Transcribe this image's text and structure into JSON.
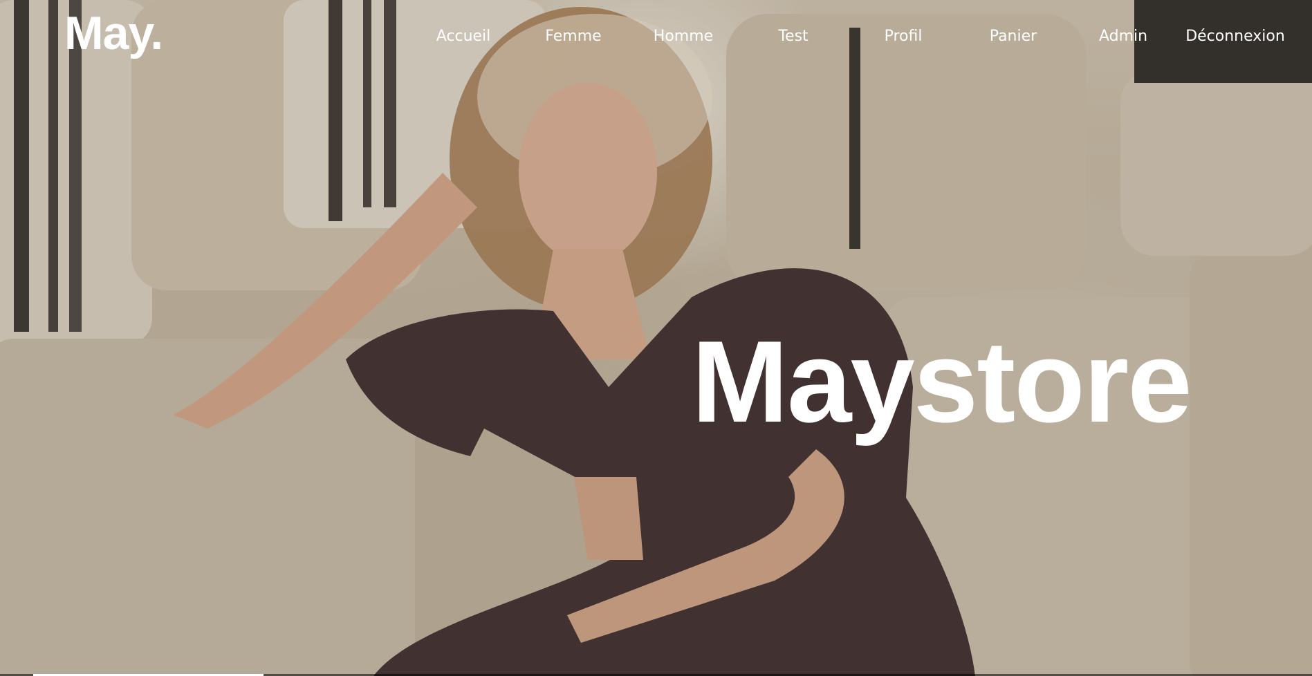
{
  "brand": {
    "logo": "May."
  },
  "nav": {
    "items": [
      {
        "label": "Accueil"
      },
      {
        "label": "Femme"
      },
      {
        "label": "Homme"
      },
      {
        "label": "Test"
      },
      {
        "label": "Profil"
      },
      {
        "label": "Panier"
      },
      {
        "label": "Admin"
      },
      {
        "label": "Déconnexion"
      }
    ]
  },
  "hero": {
    "title": "Maystore",
    "image": "woman-on-sofa-photo"
  },
  "slider": {
    "progress": 0.18
  },
  "colors": {
    "text": "#ffffff",
    "sofa": "#d7cab6",
    "background": "#3a332d"
  }
}
